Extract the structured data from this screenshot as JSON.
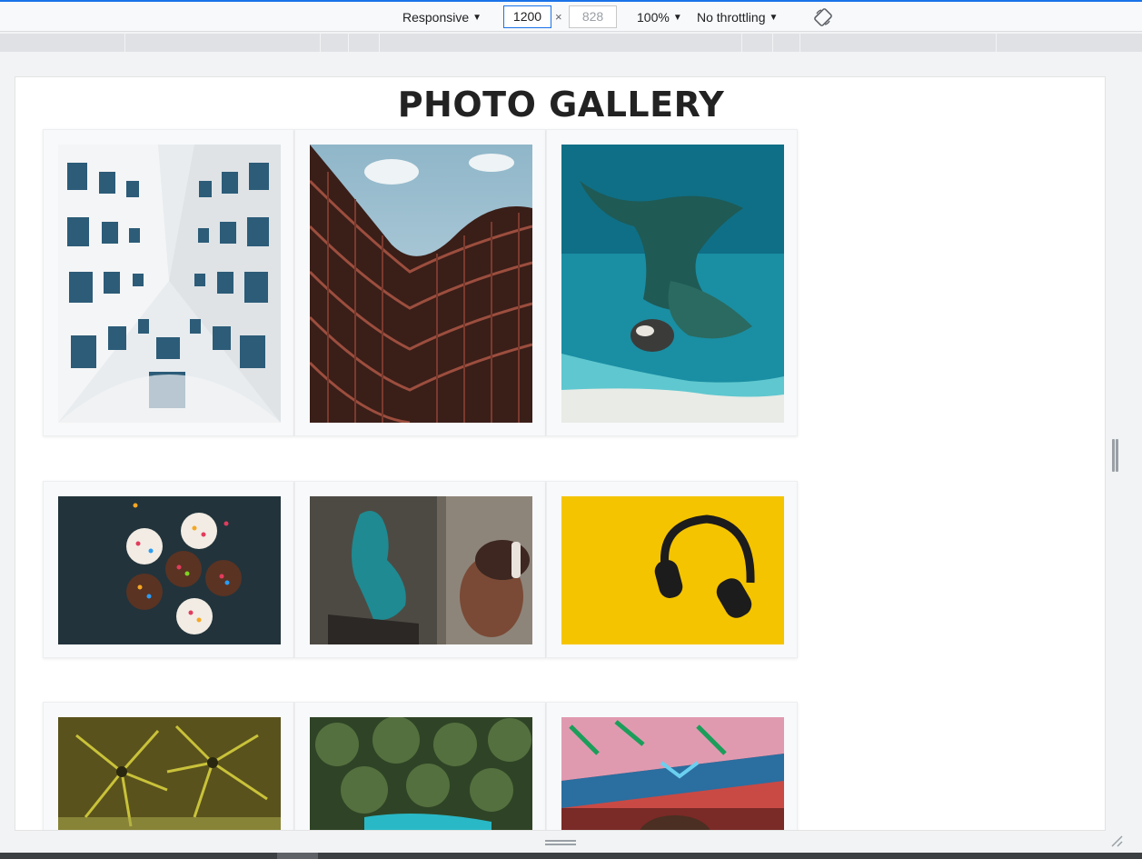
{
  "toolbar": {
    "device_label": "Responsive",
    "width_value": "1200",
    "height_placeholder": "828",
    "times_glyph": "×",
    "zoom_label": "100%",
    "throttle_label": "No throttling",
    "caret": "▼",
    "rotate_icon": "rotate-icon"
  },
  "page": {
    "title": "PHOTO GALLERY"
  },
  "gallery": {
    "photos": [
      {
        "subject": "tall white building looking up",
        "icon": "building-photo"
      },
      {
        "subject": "curved brown building against sky",
        "icon": "curved-building-photo"
      },
      {
        "subject": "aerial ocean with rocky island",
        "icon": "ocean-aerial-photo"
      },
      {
        "subject": "cupcakes with sprinkles",
        "icon": "cupcakes-photo"
      },
      {
        "subject": "graffiti wall and person with headphones",
        "icon": "graffiti-person-photo"
      },
      {
        "subject": "black headphones on yellow",
        "icon": "headphones-photo"
      },
      {
        "subject": "palm trees from above yellow",
        "icon": "palms-yellow-photo"
      },
      {
        "subject": "palm trees and pool from above",
        "icon": "palms-pool-photo"
      },
      {
        "subject": "colorful graffiti and person",
        "icon": "graffiti-colorful-photo"
      }
    ]
  },
  "colors": {
    "accent": "#1a73e8",
    "headphones_bg": "#f5c400",
    "ocean": "#1aa3b5"
  }
}
